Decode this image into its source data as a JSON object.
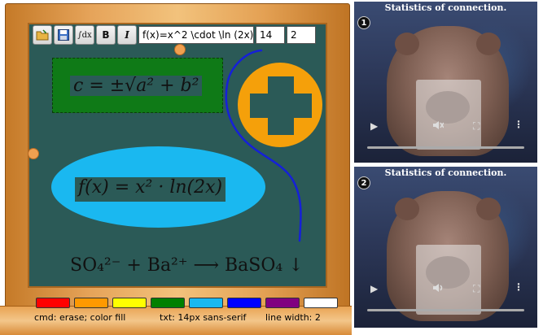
{
  "toolbar": {
    "formula_input": "f(x)=x^2 \\cdot \\ln (2x)",
    "font_size_input": "14",
    "line_width_input": "2",
    "bold_label": "B",
    "italic_label": "I",
    "formula_label": "∫dx"
  },
  "board": {
    "formula1": "c = ±√a² + b²",
    "formula2": "f(x) = x² · ln(2x)",
    "formula3": "SO₄²⁻ + Ba²⁺ ⟶ BaSO₄ ↓"
  },
  "swatches": [
    "#ff0000",
    "#ff9900",
    "#ffff00",
    "#008000",
    "#1ab8f0",
    "#0000ff",
    "#800080",
    "#ffffff"
  ],
  "status": {
    "cmd": "cmd: erase; color fill",
    "txt": "txt: 14px sans-serif",
    "line": "line width: 2"
  },
  "videos": [
    {
      "number": "1",
      "title": "Statistics of connection."
    },
    {
      "number": "2",
      "title": "Statistics of connection."
    }
  ]
}
